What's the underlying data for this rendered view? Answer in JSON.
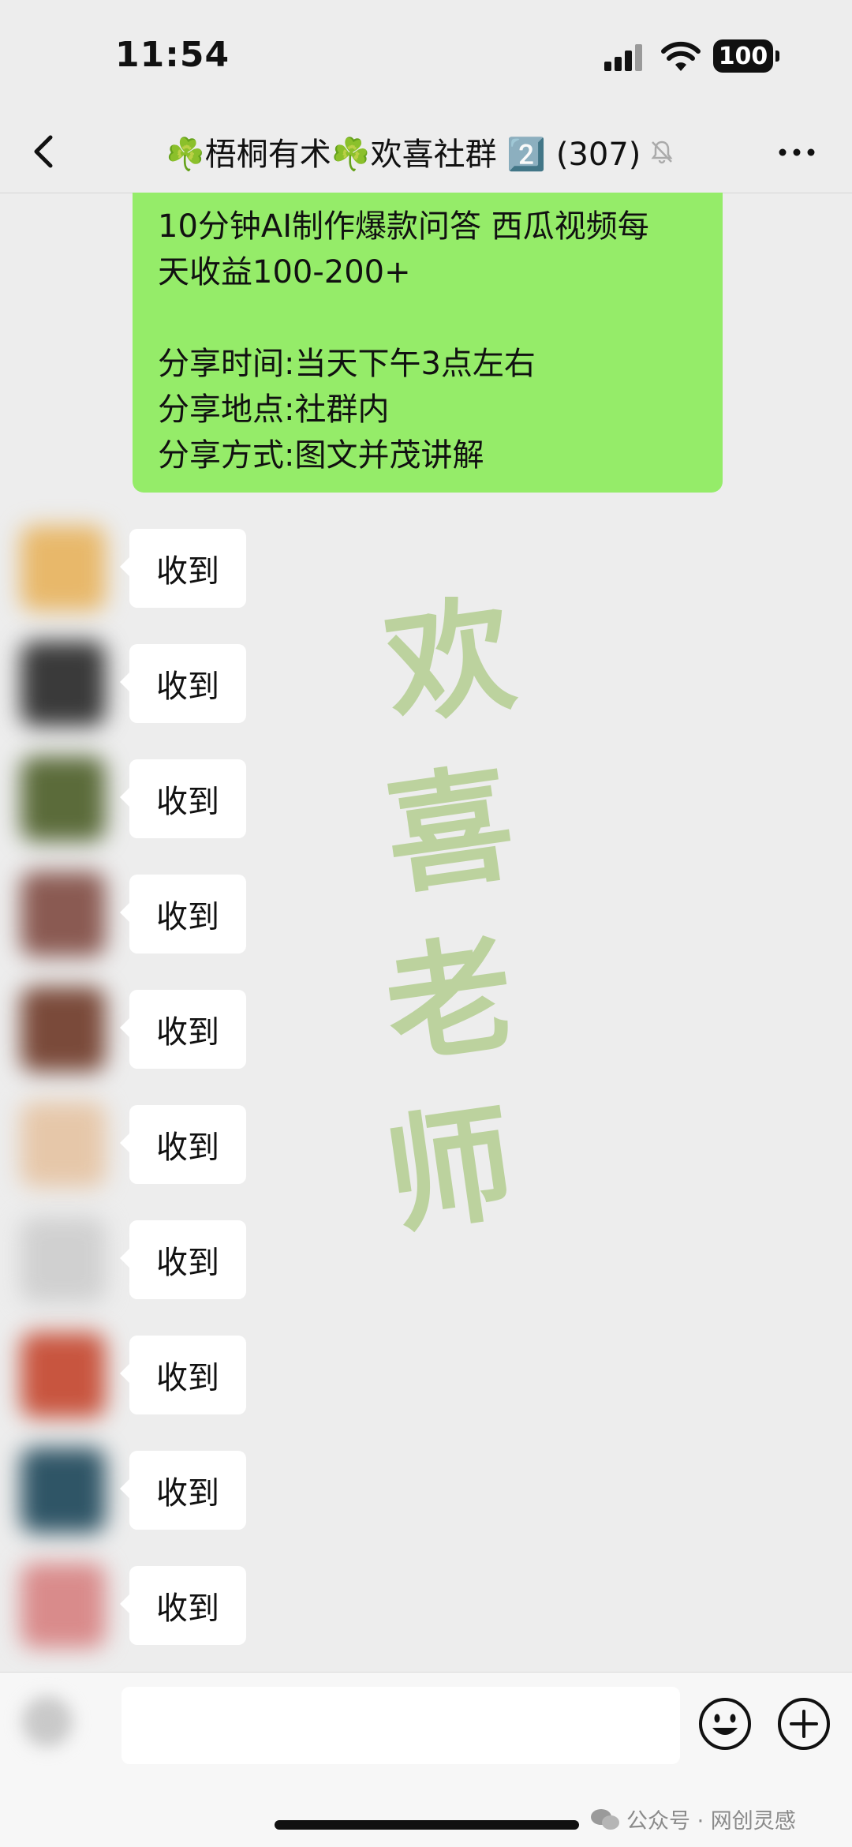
{
  "status_bar": {
    "time": "11:54",
    "battery": "100"
  },
  "nav": {
    "title": "☘️梧桐有术☘️欢喜社群 2️⃣ (307)"
  },
  "announcement": {
    "text": "10分钟AI制作爆款问答  西瓜视频每\n天收益100-200+\n\n分享时间:当天下午3点左右\n分享地点:社群内\n分享方式:图文并茂讲解"
  },
  "replies": [
    {
      "text": "收到",
      "avatar_color": "#e8b86a"
    },
    {
      "text": "收到",
      "avatar_color": "#3a3a3a"
    },
    {
      "text": "收到",
      "avatar_color": "#5b6b3a"
    },
    {
      "text": "收到",
      "avatar_color": "#8a5a52"
    },
    {
      "text": "收到",
      "avatar_color": "#7a4a3a"
    },
    {
      "text": "收到",
      "avatar_color": "#e6c7a9"
    },
    {
      "text": "收到",
      "avatar_color": "#d0d0d0"
    },
    {
      "text": "收到",
      "avatar_color": "#c8553f"
    },
    {
      "text": "收到",
      "avatar_color": "#2f5566"
    },
    {
      "text": "收到",
      "avatar_color": "#d98b8b"
    }
  ],
  "watermark": {
    "chars": [
      "欢",
      "喜",
      "老",
      "师"
    ],
    "color": "#b7d096"
  },
  "input_bar": {
    "emoji_icon": "smile-icon",
    "plus_icon": "plus-circle-icon"
  },
  "source": {
    "label": "公众号 · 网创灵感"
  },
  "colors": {
    "background": "#ededed",
    "self_bubble": "#95ec69",
    "other_bubble": "#ffffff"
  }
}
